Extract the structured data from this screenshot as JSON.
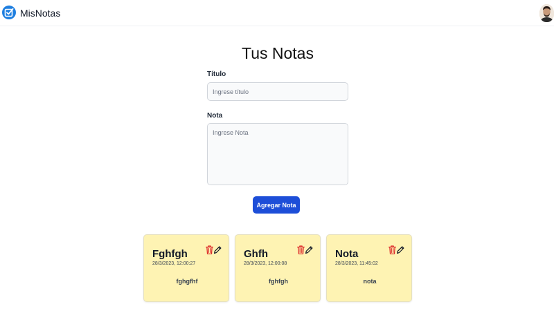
{
  "app": {
    "brand": "MisNotas"
  },
  "form": {
    "heading": "Tus Notas",
    "title_label": "Título",
    "title_placeholder": "Ingrese título",
    "note_label": "Nota",
    "note_placeholder": "Ingrese Nota",
    "add_button": "Agregar Nota"
  },
  "notes": [
    {
      "title": "Fghfgh",
      "date": "28/3/2023, 12:00:27",
      "body": "fghgfhf"
    },
    {
      "title": "Ghfh",
      "date": "28/3/2023, 12:00:08",
      "body": "fghfgh"
    },
    {
      "title": "Nota",
      "date": "28/3/2023, 11:45:02",
      "body": "nota"
    }
  ],
  "colors": {
    "logo": "#1f7fe0",
    "button": "#1d4ed8",
    "card_background": "#fef3b3",
    "trash_icon": "#dc2626"
  },
  "icons": {
    "logo": "checkbox-icon",
    "delete": "trash-icon",
    "edit": "pencil-icon"
  }
}
